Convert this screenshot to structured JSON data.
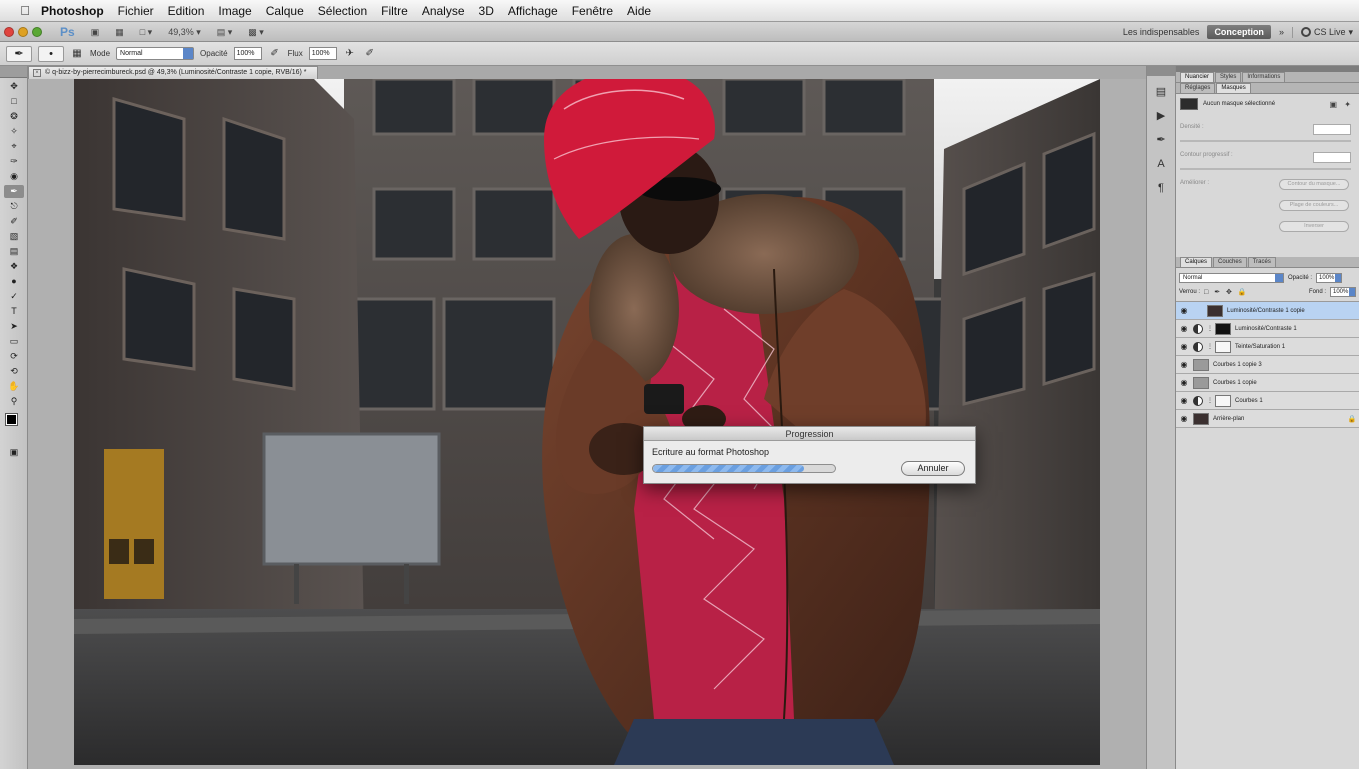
{
  "menubar": {
    "app_name": "Photoshop",
    "items": [
      "Fichier",
      "Edition",
      "Image",
      "Calque",
      "Sélection",
      "Filtre",
      "Analyse",
      "3D",
      "Affichage",
      "Fenêtre",
      "Aide"
    ]
  },
  "appbar": {
    "logo": "Ps",
    "zoom": "49,3%",
    "workspace_items": [
      "Les indispensables",
      "Conception"
    ],
    "more": "»",
    "cs_live": "CS Live"
  },
  "options": {
    "mode_label": "Mode",
    "mode_value": "Normal",
    "opacity_label": "Opacité",
    "opacity_value": "100%",
    "flow_label": "Flux",
    "flow_value": "100%"
  },
  "document": {
    "tab_title": "© q-bizz-by-pierrecimbureck.psd @ 49,3% (Luminosité/Contraste 1 copie, RVB/16) *"
  },
  "progress": {
    "title": "Progression",
    "message": "Ecriture au format Photoshop",
    "fraction": 0.83,
    "cancel_label": "Annuler"
  },
  "masks_panel": {
    "tabs": [
      "Nuancier",
      "Styles",
      "Informations"
    ],
    "subtabs": [
      "Réglages",
      "Masques"
    ],
    "header": "Aucun masque sélectionné",
    "density": "Densité :",
    "feather": "Contour progressif :",
    "refine": "Améliorer :",
    "btn_mask_edge": "Contour du masque...",
    "btn_color_range": "Plage de couleurs...",
    "btn_invert": "Inverser"
  },
  "layers_panel": {
    "tabs": [
      "Calques",
      "Couches",
      "Tracés"
    ],
    "blend_mode": "Normal",
    "opacity_label": "Opacité :",
    "opacity_value": "100%",
    "lock_label": "Verrou :",
    "fill_label": "Fond :",
    "fill_value": "100%",
    "layers": [
      {
        "name": "Luminosité/Contraste 1 copie"
      },
      {
        "name": "Luminosité/Contraste 1"
      },
      {
        "name": "Teinte/Saturation 1"
      },
      {
        "name": "Courbes 1 copie 3"
      },
      {
        "name": "Courbes 1 copie"
      },
      {
        "name": "Courbes 1"
      },
      {
        "name": "Arrière-plan"
      }
    ]
  },
  "colors": {
    "accent": "#5b86c8",
    "selected_layer": "#b9d3f2",
    "progress_fill": "#6a9fe0"
  }
}
